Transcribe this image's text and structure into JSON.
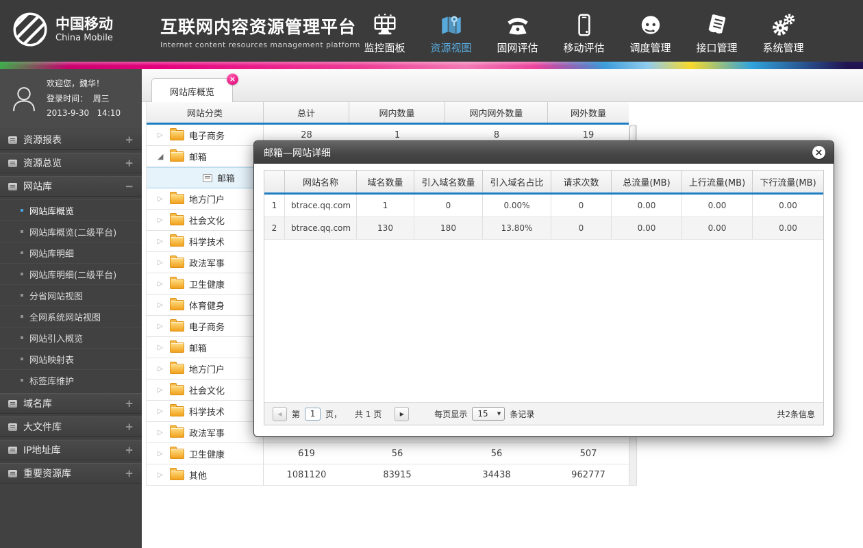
{
  "header": {
    "logo_cn": "中国移动",
    "logo_en": "China Mobile",
    "title": "互联网内容资源管理平台",
    "subtitle": "Internet content resources management platform",
    "nav": [
      {
        "label": "监控面板"
      },
      {
        "label": "资源视图"
      },
      {
        "label": "固网评估"
      },
      {
        "label": "移动评估"
      },
      {
        "label": "调度管理"
      },
      {
        "label": "接口管理"
      },
      {
        "label": "系统管理"
      }
    ]
  },
  "user_panel": {
    "line1": "欢迎您，魏华！",
    "line2": "登录时间：  周三",
    "line3": "2013-9-30   14:10"
  },
  "sidebar": {
    "groups": [
      {
        "label": "资源报表",
        "toggle": "+"
      },
      {
        "label": "资源总览",
        "toggle": "+"
      },
      {
        "label": "网站库",
        "toggle": "−"
      },
      {
        "label": "域名库",
        "toggle": "+"
      },
      {
        "label": "大文件库",
        "toggle": "+"
      },
      {
        "label": "IP地址库",
        "toggle": "+"
      },
      {
        "label": "重要资源库",
        "toggle": "+"
      }
    ],
    "website_children": [
      {
        "label": "网站库概览"
      },
      {
        "label": "网站库概览(二级平台)"
      },
      {
        "label": "网站库明细"
      },
      {
        "label": "网站库明细(二级平台)"
      },
      {
        "label": "分省网站视图"
      },
      {
        "label": "全网系统网站视图"
      },
      {
        "label": "网站引入概览"
      },
      {
        "label": "网站映射表"
      },
      {
        "label": "标签库维护"
      }
    ]
  },
  "tabs": {
    "active": "网站库概览"
  },
  "icons": {
    "collapsed": "▷",
    "expanded": "◢",
    "prev": "◀",
    "next": "▶",
    "caret": "▼",
    "close": "×"
  },
  "main_table": {
    "headers": [
      "网站分类",
      "总计",
      "网内数量",
      "网内网外数量",
      "网外数量"
    ],
    "rows": [
      {
        "label": "电子商务",
        "values": [
          "28",
          "1",
          "8",
          "19"
        ]
      },
      {
        "label": "邮箱",
        "values": [
          "",
          "",
          "",
          ""
        ]
      },
      {
        "label": "邮箱",
        "values": [
          "",
          "",
          "",
          ""
        ]
      },
      {
        "label": "地方门户",
        "values": [
          "",
          "",
          "",
          ""
        ]
      },
      {
        "label": "社会文化",
        "values": [
          "",
          "",
          "",
          ""
        ]
      },
      {
        "label": "科学技术",
        "values": [
          "",
          "",
          "",
          ""
        ]
      },
      {
        "label": "政法军事",
        "values": [
          "",
          "",
          "",
          ""
        ]
      },
      {
        "label": "卫生健康",
        "values": [
          "",
          "",
          "",
          ""
        ]
      },
      {
        "label": "体育健身",
        "values": [
          "",
          "",
          "",
          ""
        ]
      },
      {
        "label": "电子商务",
        "values": [
          "",
          "",
          "",
          ""
        ]
      },
      {
        "label": "邮箱",
        "values": [
          "",
          "",
          "",
          ""
        ]
      },
      {
        "label": "地方门户",
        "values": [
          "",
          "",
          "",
          ""
        ]
      },
      {
        "label": "社会文化",
        "values": [
          "",
          "",
          "",
          ""
        ]
      },
      {
        "label": "科学技术",
        "values": [
          "",
          "",
          "",
          ""
        ]
      },
      {
        "label": "政法军事",
        "values": [
          "",
          "",
          "",
          ""
        ]
      },
      {
        "label": "卫生健康",
        "values": [
          "619",
          "56",
          "56",
          "507"
        ]
      },
      {
        "label": "其他",
        "values": [
          "1081120",
          "83915",
          "34438",
          "962777"
        ]
      }
    ]
  },
  "modal": {
    "title": "邮箱—网站详细",
    "headers": [
      "",
      "网站名称",
      "域名数量",
      "引入域名数量",
      "引入域名占比",
      "请求次数",
      "总流量(MB)",
      "上行流量(MB)",
      "下行流量(MB)"
    ],
    "rows": [
      [
        "1",
        "btrace.qq.com",
        "1",
        "0",
        "0.00%",
        "0",
        "0.00",
        "0.00",
        "0.00"
      ],
      [
        "2",
        "btrace.qq.com",
        "130",
        "180",
        "13.80%",
        "0",
        "0.00",
        "0.00",
        "0.00"
      ]
    ],
    "pagination": {
      "prefix": "第",
      "page": "1",
      "suffix": "页，",
      "total_pages": "共 1 页",
      "per_page_label": "每页显示",
      "per_page": "15",
      "records_label": "条记录",
      "total_info": "共2条信息"
    }
  }
}
